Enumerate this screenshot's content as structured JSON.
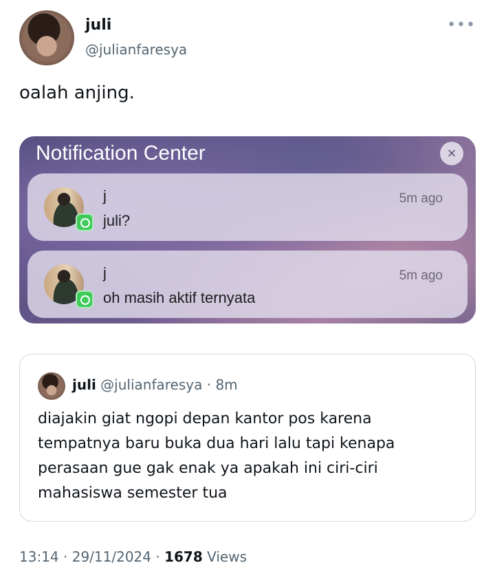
{
  "author": {
    "name": "juli",
    "handle": "@julianfaresya"
  },
  "tweet": {
    "text": "oalah anjing."
  },
  "more_icon": "more-horizontal-icon",
  "notification_center": {
    "title": "Notification Center",
    "close_glyph": "×",
    "items": [
      {
        "sender": "j",
        "message": "juli?",
        "time": "5m ago",
        "app_icon": "whatsapp-icon"
      },
      {
        "sender": "j",
        "message": "oh masih aktif ternyata",
        "time": "5m ago",
        "app_icon": "whatsapp-icon"
      }
    ]
  },
  "quote": {
    "name": "juli",
    "handle": "@julianfaresya",
    "separator": " · ",
    "age": "8m",
    "text": "diajakin giat ngopi depan kantor pos karena tempatnya baru buka dua hari lalu tapi kenapa perasaan gue gak enak ya apakah ini ciri-ciri mahasiswa semester tua"
  },
  "footer": {
    "time": "13:14",
    "sep1": " · ",
    "date": "29/11/2024",
    "sep2": " · ",
    "views_count": "1678",
    "views_label": " Views"
  },
  "colors": {
    "text": "#0f1419",
    "secondary": "#536471",
    "border": "#cfd9de",
    "whatsapp": "#3ecb5a"
  }
}
